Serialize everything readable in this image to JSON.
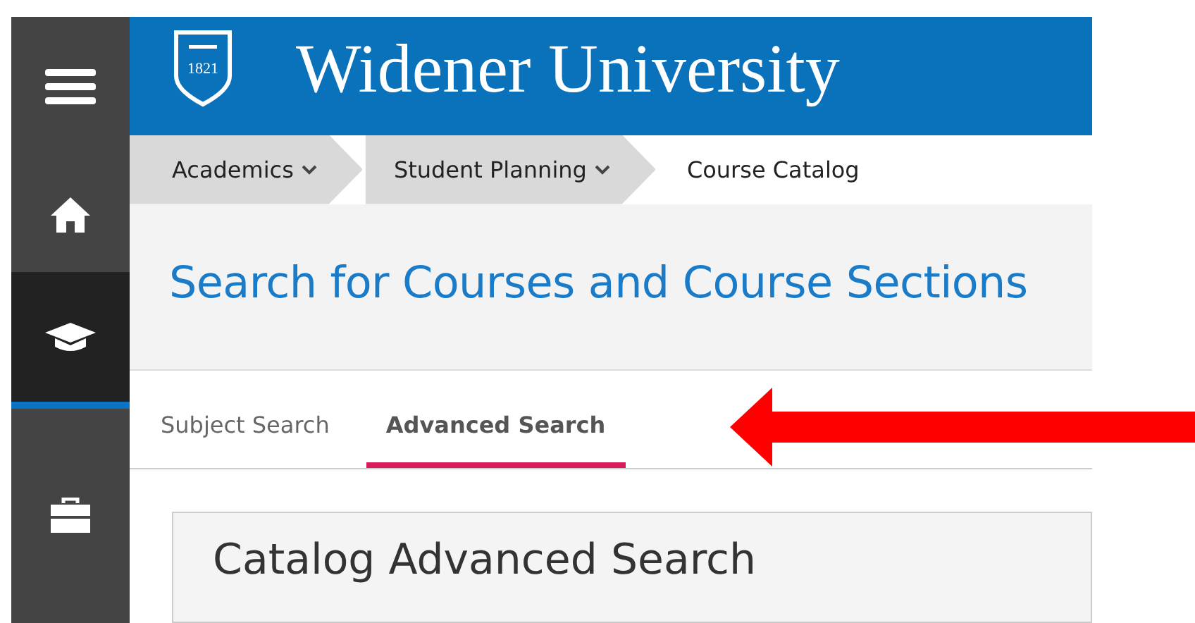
{
  "sidebar": {
    "items": [
      {
        "kind": "menu",
        "selected": false
      },
      {
        "kind": "home",
        "selected": false
      },
      {
        "kind": "academics",
        "selected": true
      },
      {
        "kind": "toolbox",
        "selected": false
      }
    ]
  },
  "header": {
    "logo_year": "1821",
    "title": "Widener University"
  },
  "breadcrumbs": [
    {
      "label": "Academics",
      "dropdown": true
    },
    {
      "label": "Student Planning",
      "dropdown": true
    },
    {
      "label": "Course Catalog",
      "dropdown": false
    }
  ],
  "page_title": "Search for Courses and Course Sections",
  "tabs": [
    {
      "label": "Subject Search",
      "selected": false
    },
    {
      "label": "Advanced Search",
      "selected": true
    }
  ],
  "card": {
    "title": "Catalog Advanced Search"
  }
}
